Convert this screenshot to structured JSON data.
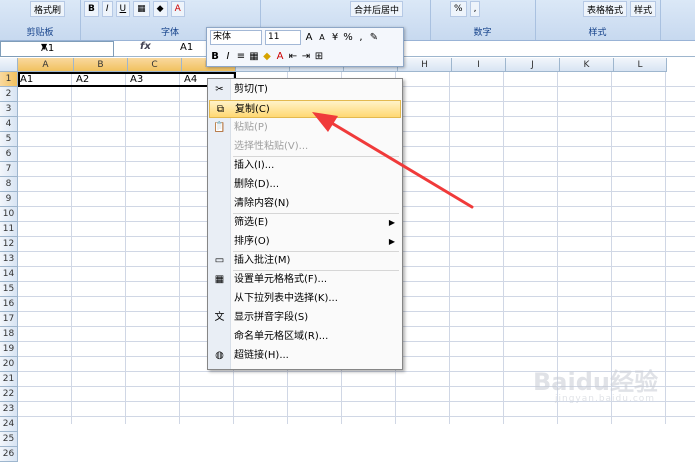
{
  "ribbon": {
    "groups": [
      {
        "label": "剪贴板",
        "buttons": [
          "格式刷"
        ]
      },
      {
        "label": "字体",
        "buttons": [
          "B",
          "I",
          "U"
        ]
      },
      {
        "label": "",
        "buttons": [
          "合并后居中"
        ]
      },
      {
        "label": "数字",
        "buttons": [
          "%",
          ","
        ]
      },
      {
        "label": "样式",
        "buttons": [
          "表格格式",
          "样式"
        ]
      }
    ]
  },
  "formula_bar": {
    "name_box": "A1",
    "fx": "fx",
    "value": "A1"
  },
  "columns": [
    "A",
    "B",
    "C",
    "D",
    "E",
    "F",
    "G",
    "H",
    "I",
    "J",
    "K",
    "L"
  ],
  "rows": [
    "1",
    "2",
    "3",
    "4",
    "5",
    "6",
    "7",
    "8",
    "9",
    "10",
    "11",
    "12",
    "13",
    "14",
    "15",
    "16",
    "17",
    "18",
    "19",
    "20",
    "21",
    "22",
    "23",
    "24",
    "25",
    "26"
  ],
  "cells": [
    {
      "ref": "A1",
      "text": "A1"
    },
    {
      "ref": "B1",
      "text": "A2"
    },
    {
      "ref": "C1",
      "text": "A3"
    },
    {
      "ref": "D1",
      "text": "A4"
    }
  ],
  "mini_toolbar": {
    "font": "宋体",
    "size": "11",
    "row1_buttons": [
      "A",
      "A",
      "%",
      ","
    ],
    "row2_buttons": [
      "B",
      "I",
      "A"
    ]
  },
  "context_menu": [
    {
      "label": "剪切(T)",
      "icon": "scissors-icon",
      "disabled": false,
      "highlighted": false,
      "submenu": false
    },
    {
      "label": "复制(C)",
      "icon": "copy-icon",
      "disabled": false,
      "highlighted": true,
      "submenu": false
    },
    {
      "label": "粘贴(P)",
      "icon": "paste-icon",
      "disabled": true,
      "highlighted": false,
      "submenu": false
    },
    {
      "label": "选择性粘贴(V)...",
      "icon": "",
      "disabled": true,
      "highlighted": false,
      "submenu": false
    },
    {
      "label": "插入(I)...",
      "icon": "",
      "disabled": false,
      "highlighted": false,
      "submenu": false
    },
    {
      "label": "删除(D)...",
      "icon": "",
      "disabled": false,
      "highlighted": false,
      "submenu": false
    },
    {
      "label": "清除内容(N)",
      "icon": "",
      "disabled": false,
      "highlighted": false,
      "submenu": false
    },
    {
      "label": "筛选(E)",
      "icon": "",
      "disabled": false,
      "highlighted": false,
      "submenu": true
    },
    {
      "label": "排序(O)",
      "icon": "",
      "disabled": false,
      "highlighted": false,
      "submenu": true
    },
    {
      "label": "插入批注(M)",
      "icon": "comment-icon",
      "disabled": false,
      "highlighted": false,
      "submenu": false
    },
    {
      "label": "设置单元格格式(F)...",
      "icon": "format-cells-icon",
      "disabled": false,
      "highlighted": false,
      "submenu": false
    },
    {
      "label": "从下拉列表中选择(K)...",
      "icon": "",
      "disabled": false,
      "highlighted": false,
      "submenu": false
    },
    {
      "label": "显示拼音字段(S)",
      "icon": "phonetic-icon",
      "disabled": false,
      "highlighted": false,
      "submenu": false
    },
    {
      "label": "命名单元格区域(R)...",
      "icon": "",
      "disabled": false,
      "highlighted": false,
      "submenu": false
    },
    {
      "label": "超链接(H)...",
      "icon": "hyperlink-icon",
      "disabled": false,
      "highlighted": false,
      "submenu": false
    }
  ],
  "watermark": {
    "brand": "Baidu经验",
    "url": "jingyan.baidu.com"
  },
  "colors": {
    "menu_highlight": "#ffd873",
    "arrow": "#f03a3a",
    "header_selected": "#f1c15f"
  }
}
